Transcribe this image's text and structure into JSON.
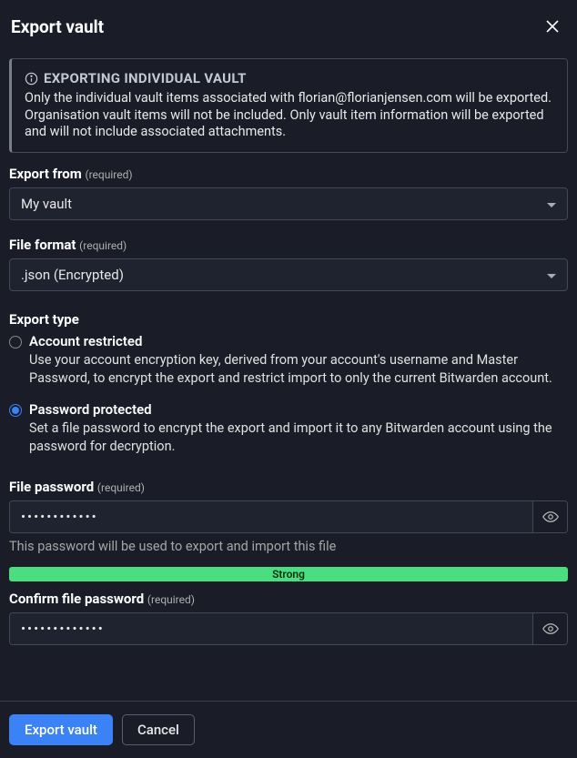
{
  "header": {
    "title": "Export vault"
  },
  "info": {
    "title": "EXPORTING INDIVIDUAL VAULT",
    "body": "Only the individual vault items associated with florian@florianjensen.com will be exported. Organisation vault items will not be included. Only vault item information will be exported and will not include associated attachments."
  },
  "export_from": {
    "label": "Export from",
    "required": "(required)",
    "value": "My vault"
  },
  "file_format": {
    "label": "File format",
    "required": "(required)",
    "value": ".json (Encrypted)"
  },
  "export_type": {
    "title": "Export type",
    "options": [
      {
        "label": "Account restricted",
        "desc": "Use your account encryption key, derived from your account's username and Master Password, to encrypt the export and restrict import to only the current Bitwarden account.",
        "selected": false
      },
      {
        "label": "Password protected",
        "desc": "Set a file password to encrypt the export and import it to any Bitwarden account using the password for decryption.",
        "selected": true
      }
    ]
  },
  "file_password": {
    "label": "File password",
    "required": "(required)",
    "value": "••••••••••••",
    "hint": "This password will be used to export and import this file"
  },
  "strength": {
    "label": "Strong"
  },
  "confirm_password": {
    "label": "Confirm file password",
    "required": "(required)",
    "value": "•••••••••••••"
  },
  "footer": {
    "primary": "Export vault",
    "secondary": "Cancel"
  }
}
